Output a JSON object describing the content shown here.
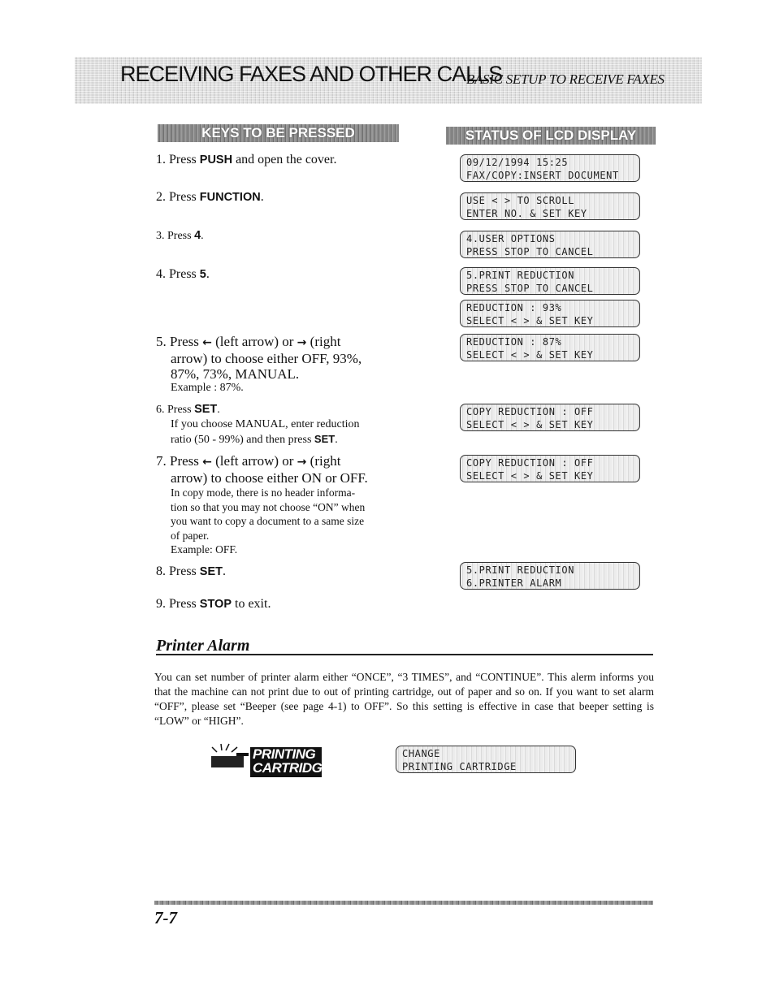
{
  "header": {
    "title": "RECEIVING FAXES AND OTHER CALLS",
    "subtitle": "BASIC SETUP TO RECEIVE FAXES"
  },
  "columns": {
    "keys_header": "KEYS TO BE PRESSED",
    "lcd_header": "STATUS OF LCD DISPLAY"
  },
  "steps": [
    {
      "num": "1.",
      "pre": "Press ",
      "key": "PUSH",
      "post": " and open the cover."
    },
    {
      "num": "2.",
      "pre": "Press ",
      "key": "FUNCTION",
      "post": "."
    },
    {
      "num": "3.",
      "pre": "Press ",
      "key": "4",
      "post": "."
    },
    {
      "num": "4.",
      "pre": "Press ",
      "key": "5",
      "post": "."
    },
    {
      "num": "5.",
      "pre": "Press",
      "left_arrow_label": "(left arrow) or",
      "right_arrow_label": "(right",
      "line2": "arrow) to choose either OFF, 93%,",
      "line3": "87%, 73%, MANUAL.",
      "note": "Example : 87%."
    },
    {
      "num": "6.",
      "pre": "Press ",
      "key": "SET",
      "post": ".",
      "note_line1": "If you choose MANUAL, enter reduction",
      "note_line2_pre": "ratio (50 - 99%) and then press ",
      "note_key": "SET",
      "note_post": "."
    },
    {
      "num": "7.",
      "pre": "Press",
      "left_arrow_label": "(left arrow) or",
      "right_arrow_label": "(right",
      "line2": "arrow) to choose either ON or OFF.",
      "note_lines": [
        "In copy mode, there is no header informa-",
        "tion so that you may not choose “ON” when",
        "you want to copy a document to a same size",
        "of paper.",
        "Example: OFF."
      ]
    },
    {
      "num": "8.",
      "pre": "Press ",
      "key": "SET",
      "post": "."
    },
    {
      "num": "9.",
      "pre": "Press ",
      "key": "STOP",
      "post": " to exit."
    }
  ],
  "arrows": {
    "left": "←",
    "right": "→"
  },
  "lcd_displays": [
    {
      "line1": "09/12/1994 15:25",
      "line2": "FAX/COPY:INSERT DOCUMENT"
    },
    {
      "line1": "USE < > TO SCROLL",
      "line2": "ENTER NO. & SET KEY"
    },
    {
      "line1": "4.USER OPTIONS",
      "line2": "PRESS STOP TO CANCEL"
    },
    {
      "line1": "5.PRINT REDUCTION",
      "line2": "PRESS STOP TO CANCEL"
    },
    {
      "line1": "REDUCTION : 93%",
      "line2": "SELECT < > & SET KEY"
    },
    {
      "line1": "REDUCTION : 87%",
      "line2": "SELECT < > & SET KEY"
    },
    {
      "line1": "COPY REDUCTION : OFF",
      "line2": "SELECT < > & SET KEY"
    },
    {
      "line1": "COPY REDUCTION : OFF",
      "line2": "SELECT < > & SET KEY"
    },
    {
      "line1": "5.PRINT REDUCTION",
      "line2": "6.PRINTER ALARM"
    },
    {
      "line1": "CHANGE",
      "line2": "PRINTING CARTRIDGE"
    }
  ],
  "printer_alarm": {
    "title": "Printer Alarm",
    "paragraph": "You can set number of printer alarm either “ONCE”, “3 TIMES”, and “CONTINUE”. This alerm informs you that the machine can not print due to out of printing cartridge, out of paper and so on. If you want to set alarm “OFF”, please set “Beeper (see page 4-1) to OFF”. So this setting  is effective in case that beeper setting is “LOW” or “HIGH”.",
    "indicator_line1": "PRINTING",
    "indicator_line2": "CARTRIDGE"
  },
  "footer": {
    "page_number": "7-7"
  }
}
